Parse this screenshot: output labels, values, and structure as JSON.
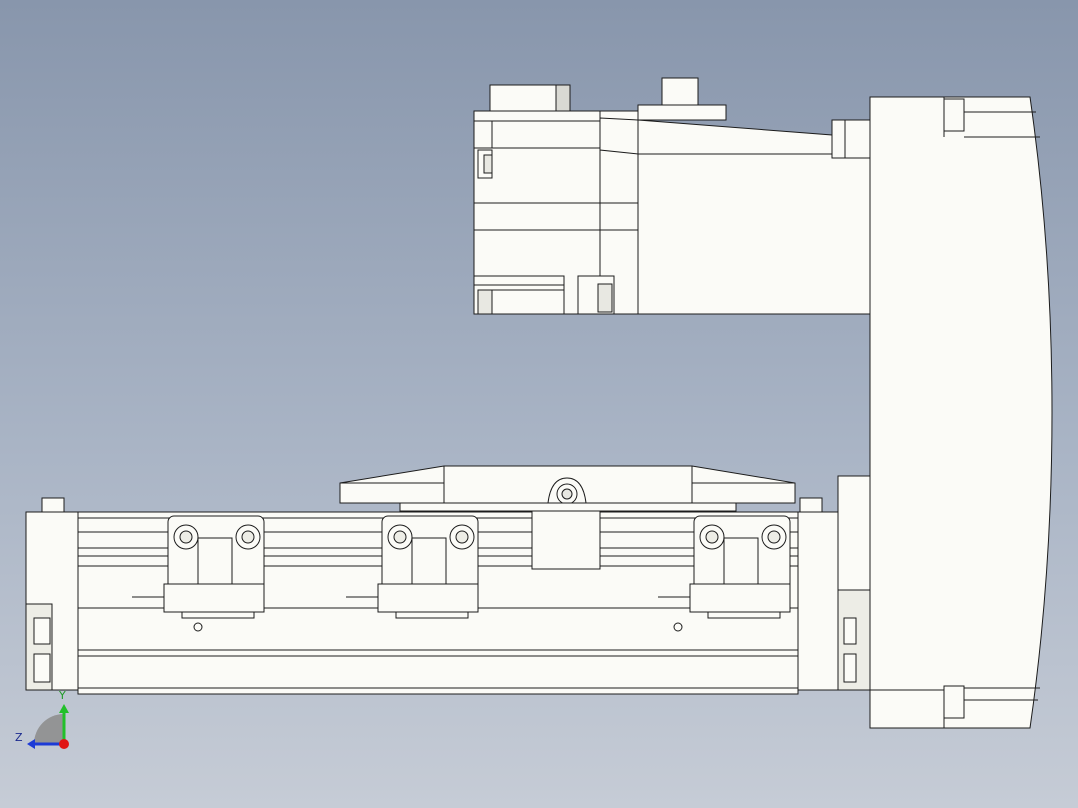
{
  "model": {
    "body_fill": "#fbfbf7",
    "shade_fill": "#ededE6",
    "edge_color": "#1c1c1c",
    "background_top": "#8896ac",
    "background_bottom": "#c6ccd6"
  },
  "triad": {
    "x_axis_label": "",
    "y_axis_label": "Y",
    "z_axis_label": "Z",
    "y_axis_color": "#22c02a",
    "z_axis_color": "#1d3bd6",
    "origin_color": "#e01515"
  }
}
